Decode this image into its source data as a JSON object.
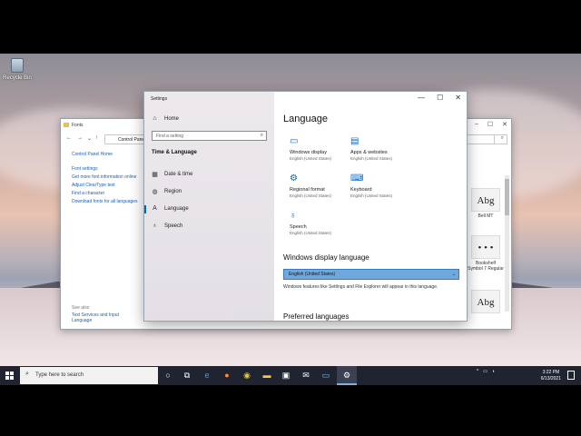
{
  "desktop": {
    "recycle_bin_label": "Recycle Bin"
  },
  "fonts_window": {
    "title": "Fonts",
    "address": "Control Pane",
    "search_icon": "search-icon",
    "sidebar_home": "Control Panel Home",
    "sidebar_links": [
      "Font settings",
      "Get more font information online",
      "Adjust ClearType text",
      "Find a character",
      "Download fonts for all languages"
    ],
    "see_also_label": "See also",
    "see_also_link": "Text Services and Input Language",
    "font_tiles": [
      {
        "preview": "Abg",
        "name": "Bell MT"
      },
      {
        "preview": "• • •",
        "name": "Bookshelf Symbol 7 Regular"
      },
      {
        "preview": "Abg",
        "name": ""
      }
    ]
  },
  "settings_window": {
    "title": "Settings",
    "controls": {
      "minimize": "—",
      "maximize": "☐",
      "close": "✕"
    },
    "nav": {
      "home": "Home",
      "search_placeholder": "Find a setting",
      "section": "Time & Language",
      "items": [
        "Date & time",
        "Region",
        "Language",
        "Speech"
      ]
    },
    "main": {
      "heading": "Language",
      "tiles": [
        {
          "icon": "monitor-icon",
          "label": "Windows display",
          "sub": "English (United States)"
        },
        {
          "icon": "browser-icon",
          "label": "Apps & websites",
          "sub": "English (United States)"
        },
        {
          "icon": "regional-format-icon",
          "label": "Regional format",
          "sub": "English (United States)"
        },
        {
          "icon": "keyboard-icon",
          "label": "Keyboard",
          "sub": "English (United States)"
        },
        {
          "icon": "microphone-icon",
          "label": "Speech",
          "sub": "English (United States)"
        }
      ],
      "display_language_heading": "Windows display language",
      "display_language_value": "English (United States)",
      "display_language_note": "Windows features like Settings and File Explorer will appear in this language.",
      "preferred_heading": "Preferred languages"
    }
  },
  "taskbar": {
    "search_placeholder": "Type here to search",
    "time": "3:22 PM",
    "date": "6/13/2021",
    "tray_chevron": "^"
  },
  "colors": {
    "accent": "#0067c0",
    "taskbar": "#1f2430",
    "selected_dropdown": "#6fa8dc"
  }
}
